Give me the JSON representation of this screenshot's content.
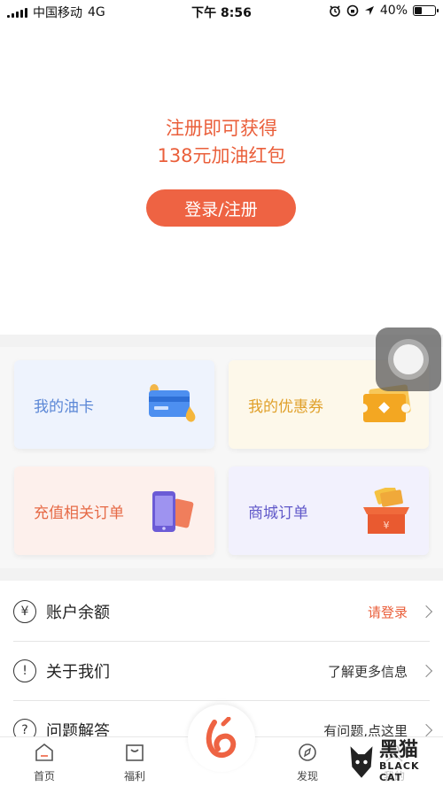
{
  "status_bar": {
    "carrier": "中国移动",
    "network": "4G",
    "time": "下午 8:56",
    "battery": "40%",
    "battery_level": 0.4
  },
  "promo": {
    "line1": "注册即可获得",
    "line2": "138元加油红包",
    "login_button": "登录/注册"
  },
  "cards": [
    {
      "label": "我的油卡",
      "icon": "fuel-card-icon",
      "color": "#5b87d6",
      "bg": "#eef3fd"
    },
    {
      "label": "我的优惠券",
      "icon": "coupon-ticket-icon",
      "color": "#e0a02a",
      "bg": "#fdf8ea"
    },
    {
      "label": "充值相关订单",
      "icon": "phone-recharge-icon",
      "color": "#e66a46",
      "bg": "#fdf0ec"
    },
    {
      "label": "商城订单",
      "icon": "gift-box-icon",
      "color": "#6159c9",
      "bg": "#f2f1fd"
    }
  ],
  "list": [
    {
      "label": "账户余额",
      "value": "请登录",
      "icon": "yuan-circle-icon",
      "glyph": "¥",
      "value_color": "#ea5f3b"
    },
    {
      "label": "关于我们",
      "value": "了解更多信息",
      "icon": "info-circle-icon",
      "glyph": "!",
      "value_color": "#333333"
    },
    {
      "label": "问题解答",
      "value": "有问题,点这里",
      "icon": "question-circle-icon",
      "glyph": "?",
      "value_color": "#333333"
    }
  ],
  "tabs": [
    {
      "label": "首页",
      "icon": "home-icon"
    },
    {
      "label": "福利",
      "icon": "bag-icon"
    },
    {
      "label": "发现",
      "icon": "compass-icon"
    },
    {
      "label": "我的",
      "icon": "profile-icon"
    }
  ],
  "watermark": {
    "big": "黑猫",
    "small": "BLACK CAT"
  },
  "colors": {
    "accent": "#ee6343"
  }
}
